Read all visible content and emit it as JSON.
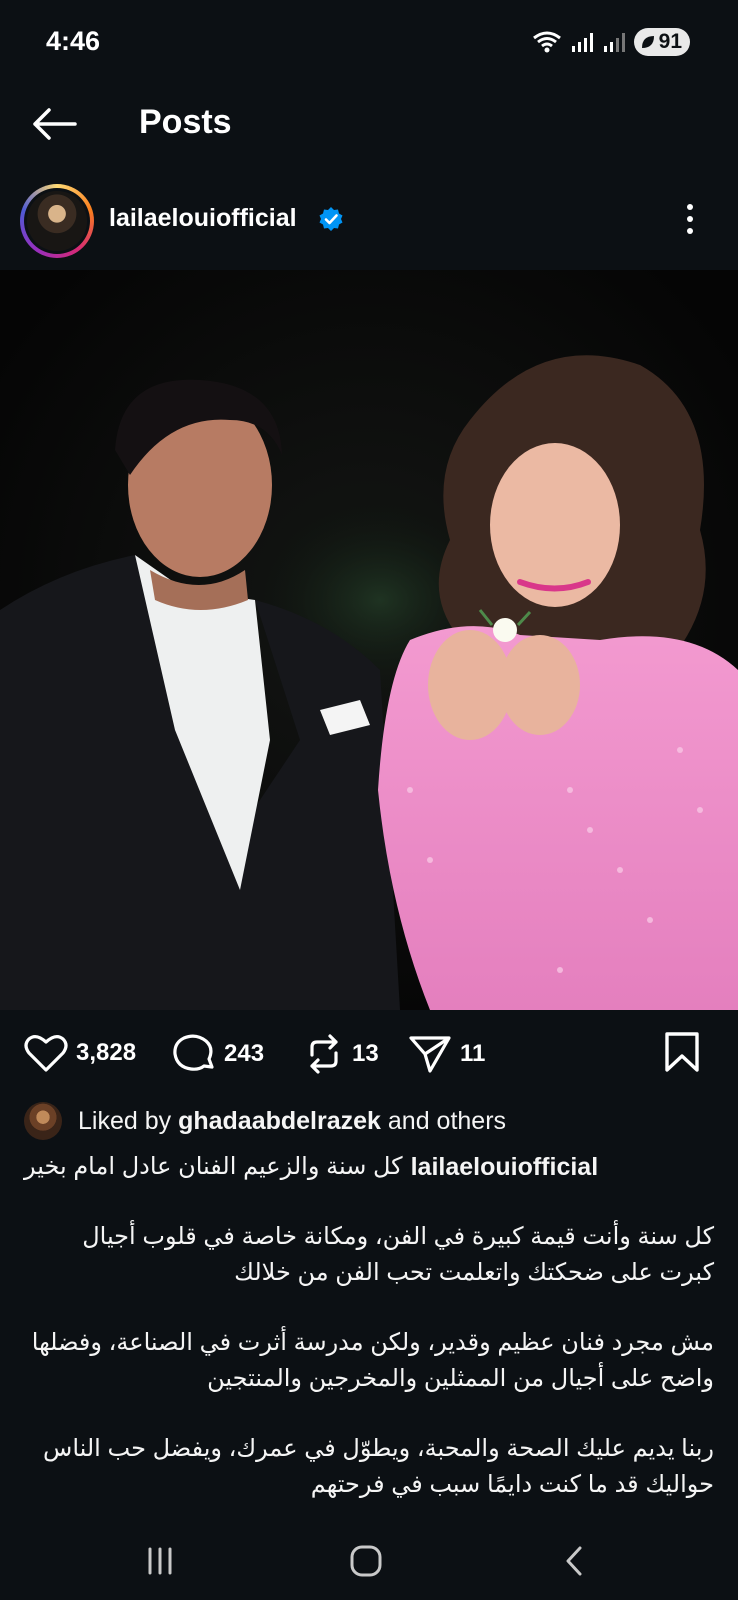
{
  "status_bar": {
    "time": "4:46",
    "battery": "91"
  },
  "header": {
    "title": "Posts"
  },
  "post": {
    "username": "lailaelouiofficial",
    "verified": true,
    "stats": {
      "likes": "3,828",
      "comments": "243",
      "reposts": "13",
      "shares": "11"
    },
    "liked_by": {
      "prefix": "Liked by",
      "user": "ghadaabdelrazek",
      "suffix": "and others"
    },
    "caption": {
      "username": "lailaelouiofficial",
      "first_line": "كل سنة والزعيم الفنان عادل امام بخير",
      "paragraphs": [
        "كل سنة وأنت قيمة كبيرة في الفن، ومكانة خاصة في قلوب أجيال كبرت على ضحكتك واتعلمت تحب الفن من خلالك",
        "مش مجرد فنان عظيم وقدير، ولكن مدرسة أثرت في الصناعة، وفضلها واضح على أجيال من الممثلين والمخرجين والمنتجين",
        "ربنا يديم عليك الصحة والمحبة، ويطوّل في عمرك، ويفضل حب الناس حواليك قد ما كنت دايمًا سبب في فرحتهم"
      ]
    }
  },
  "colors": {
    "background": "#0c1014",
    "text": "#f5f5f5",
    "verified_blue": "#0095f6"
  },
  "icons": {
    "back": "arrow-left-icon",
    "more": "more-vertical-icon",
    "like": "heart-icon",
    "comment": "comment-icon",
    "repost": "repost-icon",
    "share": "send-icon",
    "save": "bookmark-icon"
  }
}
